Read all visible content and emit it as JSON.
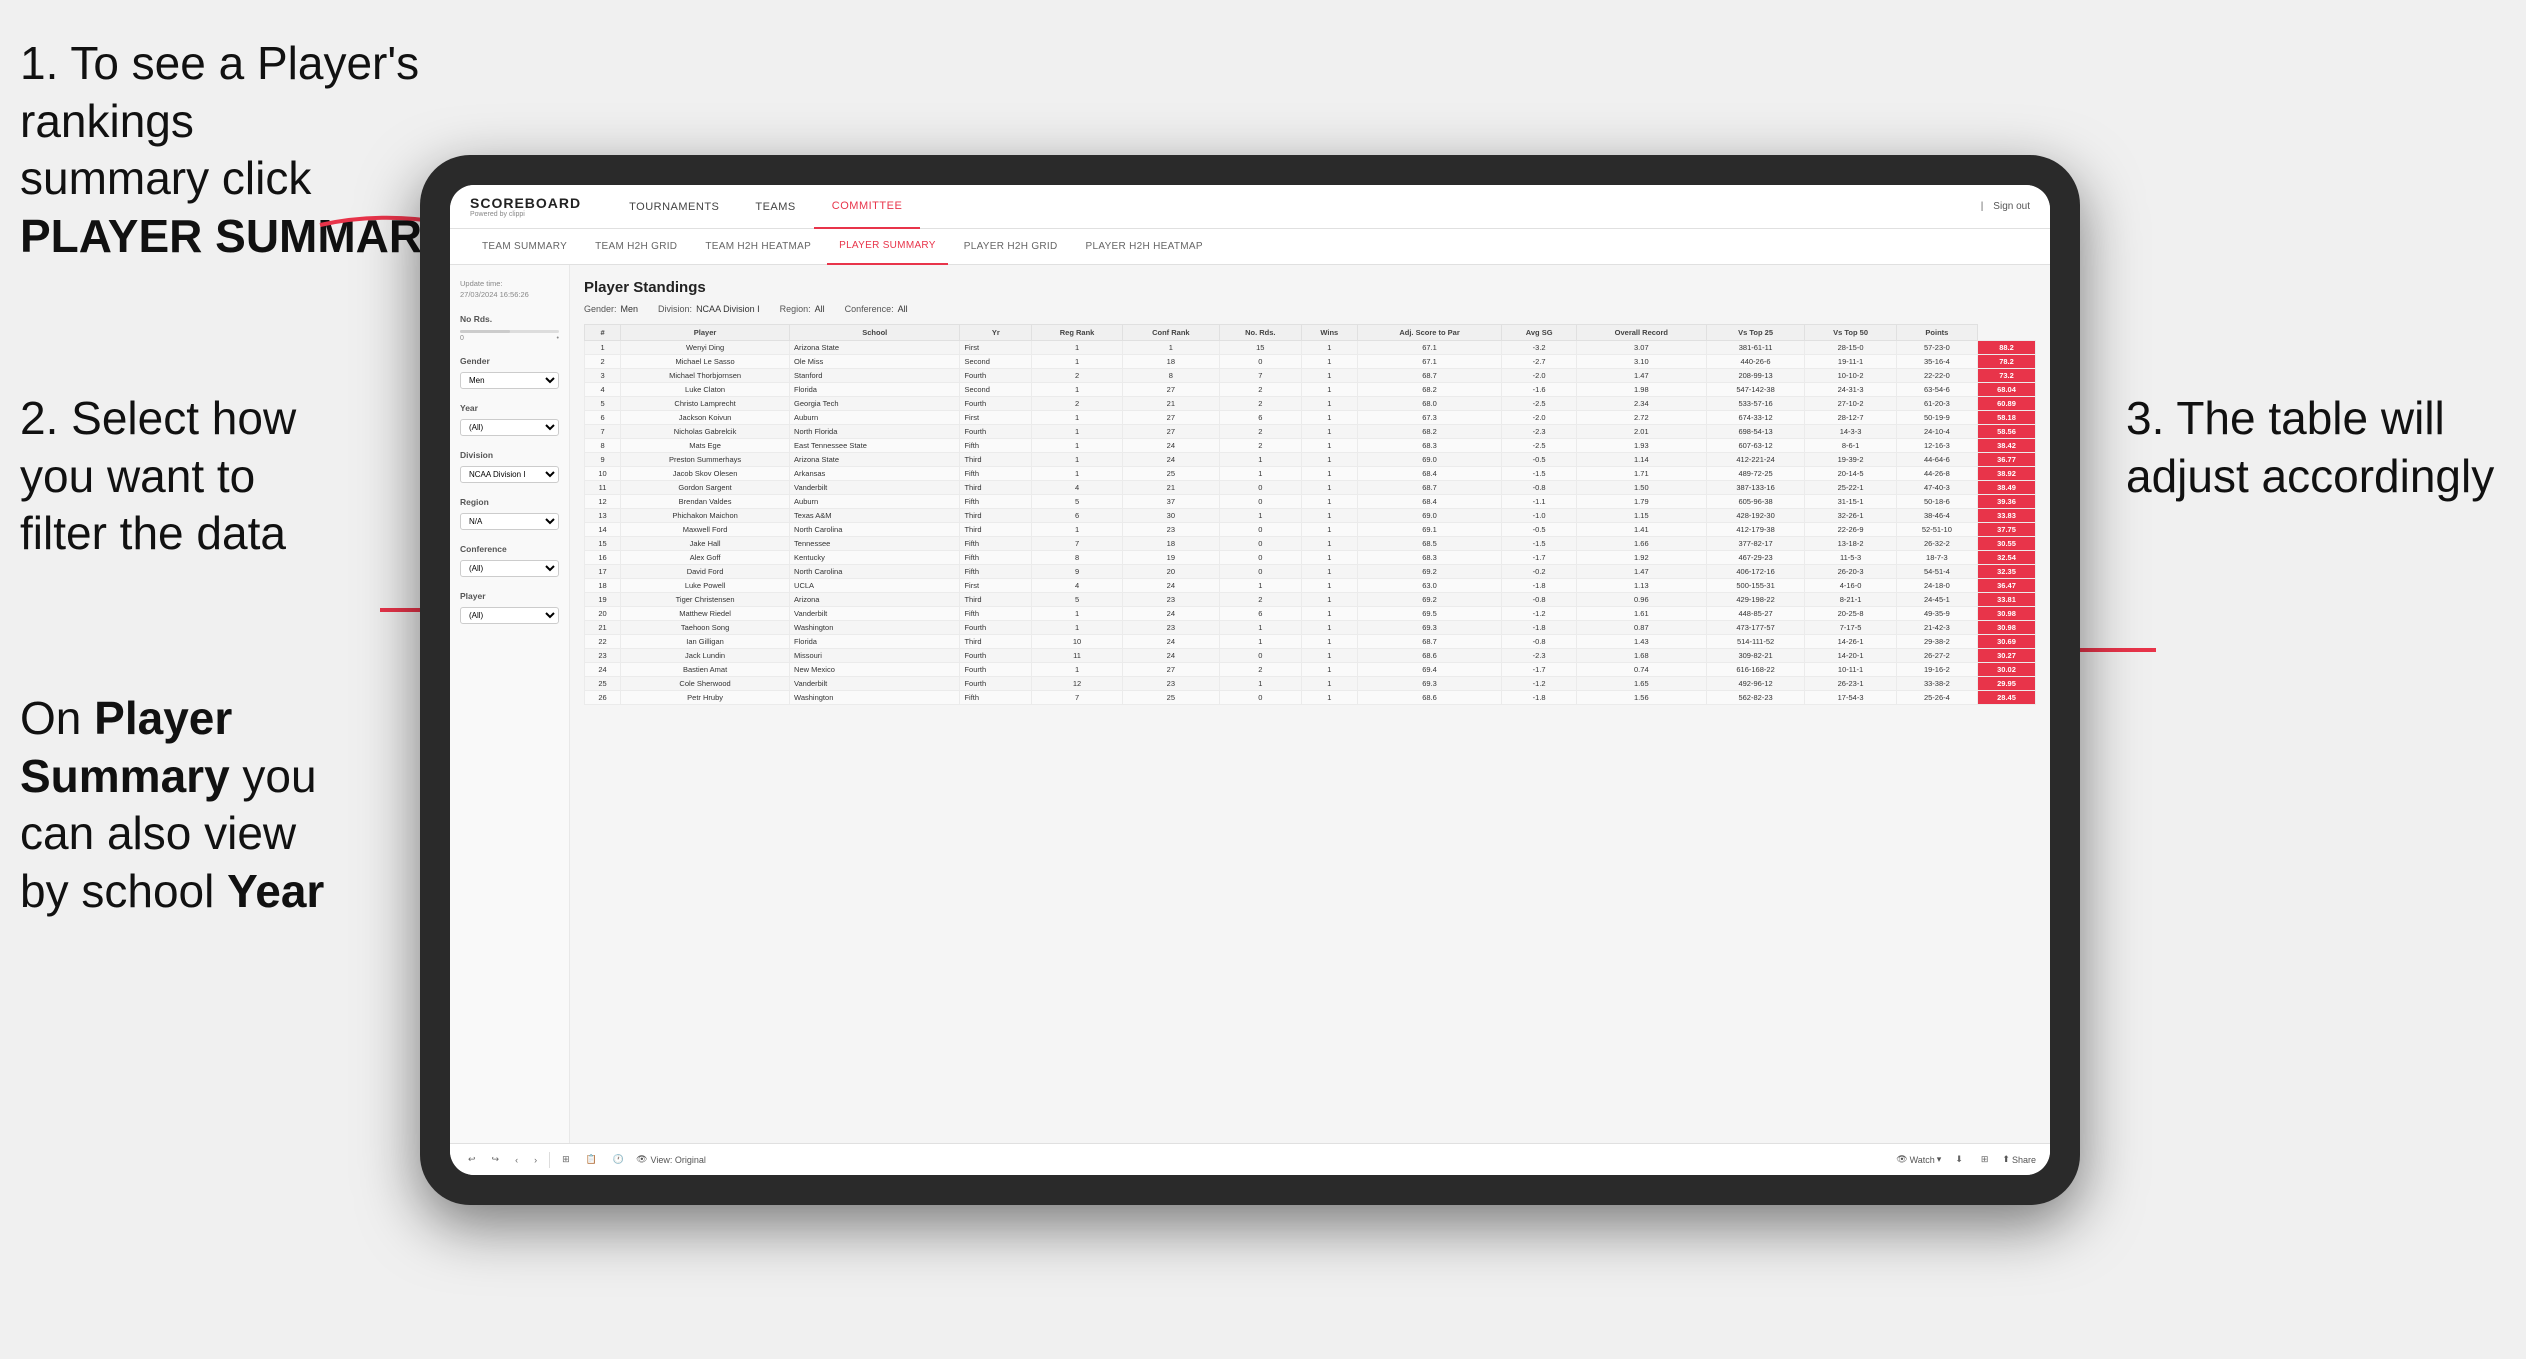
{
  "instructions": {
    "step1_line1": "1. To see a Player's rankings",
    "step1_line2": "summary click ",
    "step1_bold": "PLAYER SUMMARY",
    "step2_line1": "2. Select how",
    "step2_line2": "you want to",
    "step2_line3": "filter the data",
    "step3_line1": "3. The table will",
    "step3_line2": "adjust accordingly",
    "bottom_line1": "On ",
    "bottom_bold1": "Player",
    "bottom_line2": "Summary",
    "bottom_line3": " you",
    "bottom_line4": "can also view",
    "bottom_line5": "by school ",
    "bottom_bold2": "Year"
  },
  "app": {
    "logo": "SCOREBOARD",
    "logo_sub": "Powered by clippi",
    "nav_items": [
      "TOURNAMENTS",
      "TEAMS",
      "COMMITTEE"
    ],
    "nav_active": "COMMITTEE",
    "header_right": "Sign out",
    "sub_nav": [
      "TEAM SUMMARY",
      "TEAM H2H GRID",
      "TEAM H2H HEATMAP",
      "PLAYER SUMMARY",
      "PLAYER H2H GRID",
      "PLAYER H2H HEATMAP"
    ],
    "sub_nav_active": "PLAYER SUMMARY"
  },
  "sidebar": {
    "update_label": "Update time:",
    "update_time": "27/03/2024 16:56:26",
    "no_rds_label": "No Rds.",
    "gender_label": "Gender",
    "gender_value": "Men",
    "year_label": "Year",
    "year_value": "(All)",
    "division_label": "Division",
    "division_value": "NCAA Division I",
    "region_label": "Region",
    "region_value": "N/A",
    "conference_label": "Conference",
    "conference_value": "(All)",
    "player_label": "Player",
    "player_value": "(All)"
  },
  "table": {
    "title": "Player Standings",
    "gender_label": "Gender:",
    "gender_value": "Men",
    "division_label": "Division:",
    "division_value": "NCAA Division I",
    "region_label": "Region:",
    "region_value": "All",
    "conference_label": "Conference:",
    "conference_value": "All",
    "headers": [
      "#",
      "Player",
      "School",
      "Yr",
      "Reg Rank",
      "Conf Rank",
      "No. Rds.",
      "Wins",
      "Adj. Score to Par",
      "Avg SG",
      "Overall Record",
      "Vs Top 25",
      "Vs Top 50",
      "Points"
    ],
    "rows": [
      [
        "1",
        "Wenyi Ding",
        "Arizona State",
        "First",
        "1",
        "1",
        "15",
        "1",
        "67.1",
        "-3.2",
        "3.07",
        "381-61-11",
        "28-15-0",
        "57-23-0",
        "88.2"
      ],
      [
        "2",
        "Michael Le Sasso",
        "Ole Miss",
        "Second",
        "1",
        "18",
        "0",
        "1",
        "67.1",
        "-2.7",
        "3.10",
        "440-26-6",
        "19-11-1",
        "35-16-4",
        "78.2"
      ],
      [
        "3",
        "Michael Thorbjornsen",
        "Stanford",
        "Fourth",
        "2",
        "8",
        "7",
        "1",
        "68.7",
        "-2.0",
        "1.47",
        "208-99-13",
        "10-10-2",
        "22-22-0",
        "73.2"
      ],
      [
        "4",
        "Luke Claton",
        "Florida",
        "Second",
        "1",
        "27",
        "2",
        "1",
        "68.2",
        "-1.6",
        "1.98",
        "547-142-38",
        "24-31-3",
        "63-54-6",
        "68.04"
      ],
      [
        "5",
        "Christo Lamprecht",
        "Georgia Tech",
        "Fourth",
        "2",
        "21",
        "2",
        "1",
        "68.0",
        "-2.5",
        "2.34",
        "533-57-16",
        "27-10-2",
        "61-20-3",
        "60.89"
      ],
      [
        "6",
        "Jackson Koivun",
        "Auburn",
        "First",
        "1",
        "27",
        "6",
        "1",
        "67.3",
        "-2.0",
        "2.72",
        "674-33-12",
        "28-12-7",
        "50-19-9",
        "58.18"
      ],
      [
        "7",
        "Nicholas Gabrelcik",
        "North Florida",
        "Fourth",
        "1",
        "27",
        "2",
        "1",
        "68.2",
        "-2.3",
        "2.01",
        "698-54-13",
        "14-3-3",
        "24-10-4",
        "58.56"
      ],
      [
        "8",
        "Mats Ege",
        "East Tennessee State",
        "Fifth",
        "1",
        "24",
        "2",
        "1",
        "68.3",
        "-2.5",
        "1.93",
        "607-63-12",
        "8-6-1",
        "12-16-3",
        "38.42"
      ],
      [
        "9",
        "Preston Summerhays",
        "Arizona State",
        "Third",
        "1",
        "24",
        "1",
        "1",
        "69.0",
        "-0.5",
        "1.14",
        "412-221-24",
        "19-39-2",
        "44-64-6",
        "36.77"
      ],
      [
        "10",
        "Jacob Skov Olesen",
        "Arkansas",
        "Fifth",
        "1",
        "25",
        "1",
        "1",
        "68.4",
        "-1.5",
        "1.71",
        "489-72-25",
        "20-14-5",
        "44-26-8",
        "38.92"
      ],
      [
        "11",
        "Gordon Sargent",
        "Vanderbilt",
        "Third",
        "4",
        "21",
        "0",
        "1",
        "68.7",
        "-0.8",
        "1.50",
        "387-133-16",
        "25-22-1",
        "47-40-3",
        "38.49"
      ],
      [
        "12",
        "Brendan Valdes",
        "Auburn",
        "Fifth",
        "5",
        "37",
        "0",
        "1",
        "68.4",
        "-1.1",
        "1.79",
        "605-96-38",
        "31-15-1",
        "50-18-6",
        "39.36"
      ],
      [
        "13",
        "Phichakon Maichon",
        "Texas A&M",
        "Third",
        "6",
        "30",
        "1",
        "1",
        "69.0",
        "-1.0",
        "1.15",
        "428-192-30",
        "32-26-1",
        "38-46-4",
        "33.83"
      ],
      [
        "14",
        "Maxwell Ford",
        "North Carolina",
        "Third",
        "1",
        "23",
        "0",
        "1",
        "69.1",
        "-0.5",
        "1.41",
        "412-179-38",
        "22-26-9",
        "52-51-10",
        "37.75"
      ],
      [
        "15",
        "Jake Hall",
        "Tennessee",
        "Fifth",
        "7",
        "18",
        "0",
        "1",
        "68.5",
        "-1.5",
        "1.66",
        "377-82-17",
        "13-18-2",
        "26-32-2",
        "30.55"
      ],
      [
        "16",
        "Alex Goff",
        "Kentucky",
        "Fifth",
        "8",
        "19",
        "0",
        "1",
        "68.3",
        "-1.7",
        "1.92",
        "467-29-23",
        "11-5-3",
        "18-7-3",
        "32.54"
      ],
      [
        "17",
        "David Ford",
        "North Carolina",
        "Fifth",
        "9",
        "20",
        "0",
        "1",
        "69.2",
        "-0.2",
        "1.47",
        "406-172-16",
        "26-20-3",
        "54-51-4",
        "32.35"
      ],
      [
        "18",
        "Luke Powell",
        "UCLA",
        "First",
        "4",
        "24",
        "1",
        "1",
        "63.0",
        "-1.8",
        "1.13",
        "500-155-31",
        "4-16-0",
        "24-18-0",
        "36.47"
      ],
      [
        "19",
        "Tiger Christensen",
        "Arizona",
        "Third",
        "5",
        "23",
        "2",
        "1",
        "69.2",
        "-0.8",
        "0.96",
        "429-198-22",
        "8-21-1",
        "24-45-1",
        "33.81"
      ],
      [
        "20",
        "Matthew Riedel",
        "Vanderbilt",
        "Fifth",
        "1",
        "24",
        "6",
        "1",
        "69.5",
        "-1.2",
        "1.61",
        "448-85-27",
        "20-25-8",
        "49-35-9",
        "30.98"
      ],
      [
        "21",
        "Taehoon Song",
        "Washington",
        "Fourth",
        "1",
        "23",
        "1",
        "1",
        "69.3",
        "-1.8",
        "0.87",
        "473-177-57",
        "7-17-5",
        "21-42-3",
        "30.98"
      ],
      [
        "22",
        "Ian Gilligan",
        "Florida",
        "Third",
        "10",
        "24",
        "1",
        "1",
        "68.7",
        "-0.8",
        "1.43",
        "514-111-52",
        "14-26-1",
        "29-38-2",
        "30.69"
      ],
      [
        "23",
        "Jack Lundin",
        "Missouri",
        "Fourth",
        "11",
        "24",
        "0",
        "1",
        "68.6",
        "-2.3",
        "1.68",
        "309-82-21",
        "14-20-1",
        "26-27-2",
        "30.27"
      ],
      [
        "24",
        "Bastien Amat",
        "New Mexico",
        "Fourth",
        "1",
        "27",
        "2",
        "1",
        "69.4",
        "-1.7",
        "0.74",
        "616-168-22",
        "10-11-1",
        "19-16-2",
        "30.02"
      ],
      [
        "25",
        "Cole Sherwood",
        "Vanderbilt",
        "Fourth",
        "12",
        "23",
        "1",
        "1",
        "69.3",
        "-1.2",
        "1.65",
        "492-96-12",
        "26-23-1",
        "33-38-2",
        "29.95"
      ],
      [
        "26",
        "Petr Hruby",
        "Washington",
        "Fifth",
        "7",
        "25",
        "0",
        "1",
        "68.6",
        "-1.8",
        "1.56",
        "562-82-23",
        "17-54-3",
        "25-26-4",
        "28.45"
      ]
    ]
  },
  "toolbar": {
    "view_original": "View: Original",
    "watch": "Watch",
    "share": "Share"
  }
}
